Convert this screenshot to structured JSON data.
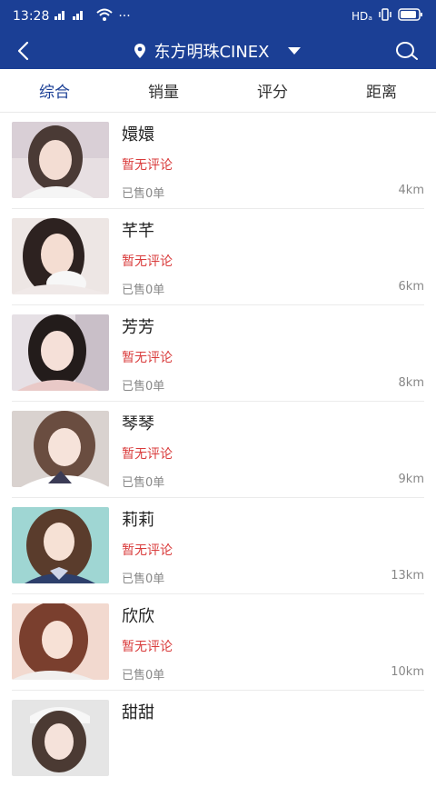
{
  "status": {
    "time": "13:28",
    "signal": "ᵀᵀ ᵀᵀ",
    "more": "···",
    "hd": "HDₐ"
  },
  "header": {
    "location": "东方明珠CINEX"
  },
  "tabs": [
    "综合",
    "销量",
    "评分",
    "距离"
  ],
  "items": [
    {
      "name": "嬛嬛",
      "review": "暂无评论",
      "sold": "已售0单",
      "distance": "4km"
    },
    {
      "name": "芊芊",
      "review": "暂无评论",
      "sold": "已售0单",
      "distance": "6km"
    },
    {
      "name": "芳芳",
      "review": "暂无评论",
      "sold": "已售0单",
      "distance": "8km"
    },
    {
      "name": "琴琴",
      "review": "暂无评论",
      "sold": "已售0单",
      "distance": "9km"
    },
    {
      "name": "莉莉",
      "review": "暂无评论",
      "sold": "已售0单",
      "distance": "13km"
    },
    {
      "name": "欣欣",
      "review": "暂无评论",
      "sold": "已售0单",
      "distance": "10km"
    },
    {
      "name": "甜甜",
      "review": "",
      "sold": "",
      "distance": ""
    }
  ],
  "colors": {
    "primary": "#1b3f95",
    "review": "#d93b3b"
  }
}
